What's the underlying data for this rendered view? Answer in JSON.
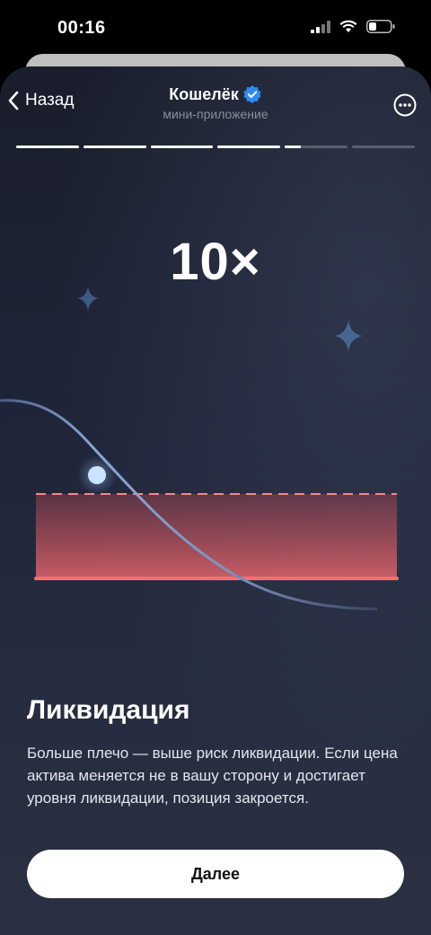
{
  "status_bar": {
    "time": "00:16",
    "icons": [
      "cellular-signal-icon",
      "wifi-icon",
      "battery-icon"
    ]
  },
  "header": {
    "back_label": "Назад",
    "title": "Кошелёк",
    "subtitle": "мини-приложение",
    "verified_icon": "verified-badge-icon",
    "more_icon": "more-options-icon"
  },
  "progress": {
    "segments": [
      1,
      1,
      1,
      1,
      0.25,
      0
    ],
    "active_color": "#ffffff",
    "inactive_color": "#5a5f6b"
  },
  "illustration": {
    "multiplier": "10×",
    "liquidation_color": "#f07272",
    "curve_color": "#6f86b3",
    "star_color": "#4a6a92"
  },
  "content": {
    "headline": "Ликвидация",
    "body": "Больше плечо — выше риск ликвидации. Если цена актива меняется не в вашу сторону и достигает уровня ликвидации, позиция закроется."
  },
  "actions": {
    "next_label": "Далее"
  }
}
